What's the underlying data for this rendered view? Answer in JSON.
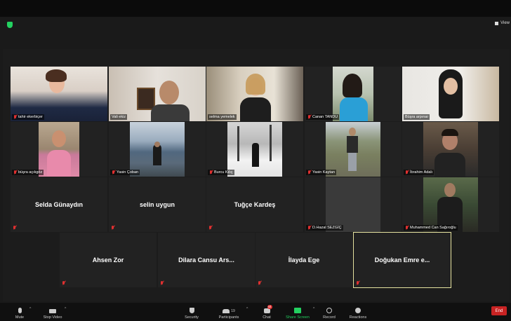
{
  "header": {
    "view_label": "View"
  },
  "participants": [
    {
      "name": "tahir ekerbiçer",
      "muted": true
    },
    {
      "name": "Vali ekiz",
      "muted": false
    },
    {
      "name": "selma yemelek",
      "muted": false
    },
    {
      "name": "Canan TANDU",
      "muted": true
    },
    {
      "name": "Büşra arpınar",
      "muted": false
    },
    {
      "name": "büşra açıkgöz",
      "muted": true
    },
    {
      "name": "Yasin Çoban",
      "muted": true
    },
    {
      "name": "Burcu Kılıç",
      "muted": true
    },
    {
      "name": "Yasin Kaytan",
      "muted": true
    },
    {
      "name": "İbrahim Adalı",
      "muted": true
    },
    {
      "name": "Selda Günaydın",
      "muted": true
    },
    {
      "name": "selin uygun",
      "muted": true
    },
    {
      "name": "Tuğçe Kardeş",
      "muted": true
    },
    {
      "name": "D.Hazal SEZGİÇ",
      "muted": true
    },
    {
      "name": "Muhammed Can Sağıroğlu",
      "muted": true
    },
    {
      "name": "Ahsen Zor",
      "muted": true
    },
    {
      "name": "Dilara Cansu Ars...",
      "muted": true
    },
    {
      "name": "İlayda Ege",
      "muted": true
    },
    {
      "name": "Doğukan Emre e...",
      "muted": true
    }
  ],
  "toolbar": {
    "mute": "Mute",
    "stop_video": "Stop Video",
    "security": "Security",
    "participants": "Participants",
    "participants_count": "19",
    "chat": "Chat",
    "chat_badge": "44",
    "share_screen": "Share Screen",
    "record": "Record",
    "reactions": "Reactions",
    "end": "End"
  },
  "colors": {
    "mute_red": "#e03030",
    "share_green": "#23d160",
    "end_red": "#c82323",
    "active_speaker_border": "#e6e3a0"
  }
}
